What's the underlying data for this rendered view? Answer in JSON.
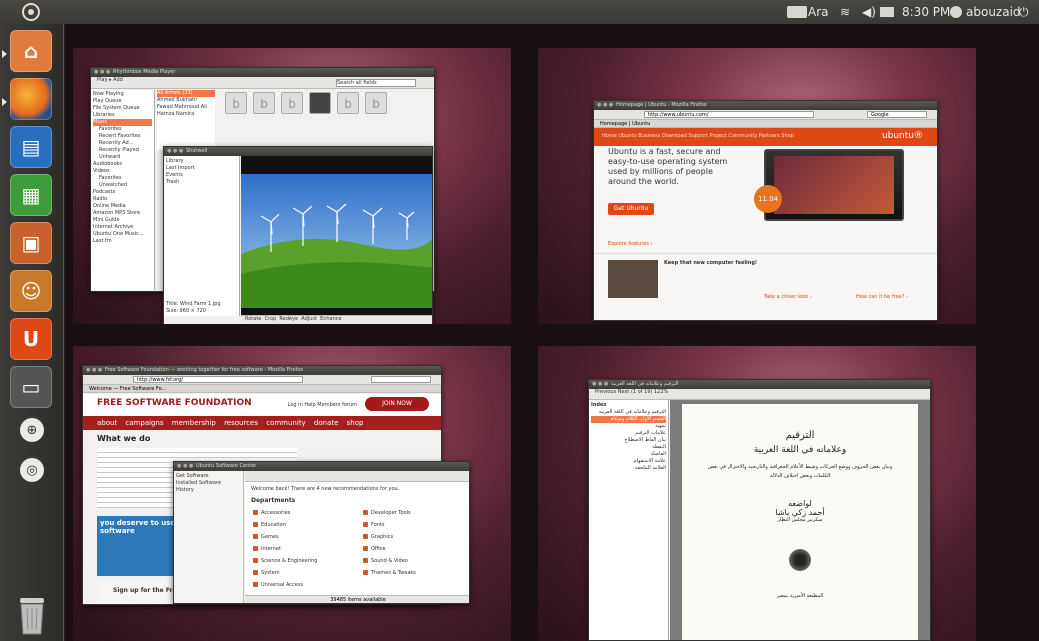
{
  "top_panel": {
    "keyboard_layout": "Ara",
    "time": "8:30 PM",
    "user": "abouzaid",
    "icons": [
      "ubuntu-logo-icon",
      "keyboard-icon",
      "wifi-icon",
      "speaker-icon",
      "mail-icon",
      "user-icon",
      "power-icon"
    ]
  },
  "launcher": {
    "items": [
      {
        "name": "home-folder",
        "color": "#e07b3c"
      },
      {
        "name": "firefox",
        "color": "#e56b1f"
      },
      {
        "name": "libreoffice-writer",
        "color": "#2a6fbf"
      },
      {
        "name": "libreoffice-calc",
        "color": "#3e9d3a"
      },
      {
        "name": "libreoffice-impress",
        "color": "#c8612b"
      },
      {
        "name": "ubuntu-software-center",
        "color": "#c77a2a"
      },
      {
        "name": "ubuntu-one",
        "color": "#dd4814",
        "glyph": "U"
      },
      {
        "name": "workspace-switcher",
        "color": "#555555"
      }
    ],
    "search_buttons": [
      "applications-lens",
      "files-lens"
    ],
    "trash": "trash"
  },
  "workspace1": {
    "rhythmbox": {
      "title": "Rhythmbox Media Player",
      "toolbar": "Play  ▸  Add",
      "search_placeholder": "Search all fields",
      "sidebar": [
        "Now Playing",
        "Play Queue",
        "File System Queue",
        "Libraries",
        "Music",
        "Favorites",
        "Recent Favorites",
        "Recently Ad...",
        "Recently Played",
        "Unheard",
        "Audiobooks",
        "Videos",
        "Favorites",
        "Unwatched",
        "Podcasts",
        "Radio",
        "Online Media",
        "Amazon MP3 Store",
        "Mini Guide",
        "Internet Archive",
        "Ubuntu One Music...",
        "Last.fm"
      ],
      "artists": [
        "All Artists (23)",
        "Ahmed Bukhatir",
        "Fawad Mahmoud Ali",
        "Hamza Namira"
      ]
    },
    "shotwell": {
      "title": "Shotwell",
      "sidebar": [
        "Library",
        "Last Import",
        "Events",
        "Trash"
      ],
      "photo_title": "Title: Wind Farm 1.jpg",
      "photo_size": "Size: 960 × 720",
      "tools": [
        "Rotate",
        "Crop",
        "Redeye",
        "Adjust",
        "Enhance"
      ]
    }
  },
  "workspace2": {
    "firefox": {
      "title": "Homepage | Ubuntu - Mozilla Firefox",
      "url": "http://www.ubuntu.com/",
      "search": "Google",
      "tab": "Homepage | Ubuntu",
      "brand": "ubuntu®",
      "nav": "Home  Ubuntu  Business  Download  Support  Project  Community  Partners  Shop",
      "headline": "Ubuntu is a fast, secure and easy-to-use operating system used by millions of people around the world.",
      "cta": "Get Ubuntu",
      "badge": "11.04",
      "feature_heading": "Keep that new computer feeling!",
      "link1": "Take a closer look ›",
      "link2": "How can it be free? ›",
      "explore": "Explore features ›"
    }
  },
  "workspace3": {
    "firefox": {
      "title": "Free Software Foundation — working together for free software - Mozilla Firefox",
      "url": "http://www.fsf.org/",
      "tab": "Welcome — Free Software Fo...",
      "brand": "FREE SOFTWARE FOUNDATION",
      "header_links": "Log in   Help   Members forum",
      "join": "JOIN NOW",
      "nav": "about campaigns membership resources community donate shop",
      "heading": "What we do",
      "banner": "you deserve to use free software",
      "signup": "Sign up for the Free Software Supporter"
    },
    "software_center": {
      "title": "Ubuntu Software Center",
      "sidebar": [
        "Get Software",
        "Installed Software",
        "History"
      ],
      "welcome": "Welcome back! There are 4 new recommendations for you.",
      "departments_heading": "Departments",
      "departments": [
        "Accessories",
        "Developer Tools",
        "Education",
        "Fonts",
        "Games",
        "Graphics",
        "Internet",
        "Office",
        "Science & Engineering",
        "Sound & Video",
        "System",
        "Themes & Tweaks",
        "Universal Access"
      ],
      "status": "39485 items available"
    }
  },
  "workspace4": {
    "evince": {
      "title": "الترقيم وعلاماته في اللغة العربية",
      "toolbar": "Previous   Next     (1 of 19)   122%",
      "index_label": "Index",
      "index_items": [
        "الترقيم وعلاماته في اللغة العربية",
        "القسم الأول: الكلام ونوعاه",
        "تمهيد",
        "علامات الترقيم",
        "بيان الفاظ الاصطلاح",
        "النقطة",
        "الفاصلة",
        "علامة الاستفهام",
        "العلامة الملحقة"
      ],
      "page_title": "الترقيم",
      "page_subtitle": "وعلاماته في اللغة العربية",
      "page_desc": "وبيان بعض الحروف ووضع الحركات وضبط الأعلام الجغرافية والتاريخية والاختزال في بعض الكلمات وبعض اختلاف الدلالة",
      "author_label": "لواضعه",
      "author": "أحمد زكي باشا",
      "author_sub": "سكرتير مجلس النظار",
      "publisher": "المطبعة الأميرية بمصر"
    }
  }
}
